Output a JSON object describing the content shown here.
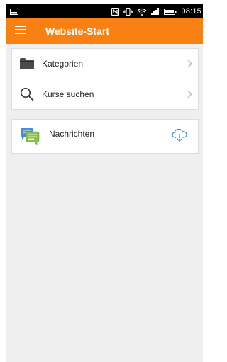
{
  "status_bar": {
    "time": "08:15",
    "icons": [
      "image-icon",
      "nfc-icon",
      "vibrate-icon",
      "wifi-icon",
      "signal-icon",
      "battery-icon"
    ]
  },
  "app_bar": {
    "title": "Website-Start",
    "background_color": "#f98012",
    "menu_icon": "hamburger-menu-icon"
  },
  "nav_items": [
    {
      "label": "Kategorien",
      "icon": "folder-icon",
      "trailing_icon": "chevron-right-icon"
    },
    {
      "label": "Kurse suchen",
      "icon": "search-icon",
      "trailing_icon": "chevron-right-icon"
    }
  ],
  "messages_item": {
    "label": "Nachrichten",
    "icon": "chat-bubbles-icon",
    "action_icon": "cloud-download-icon",
    "icon_colors": {
      "back_bubble": "#4a8fd4",
      "front_bubble": "#8bc34a"
    },
    "action_color": "#3b8fd3"
  }
}
